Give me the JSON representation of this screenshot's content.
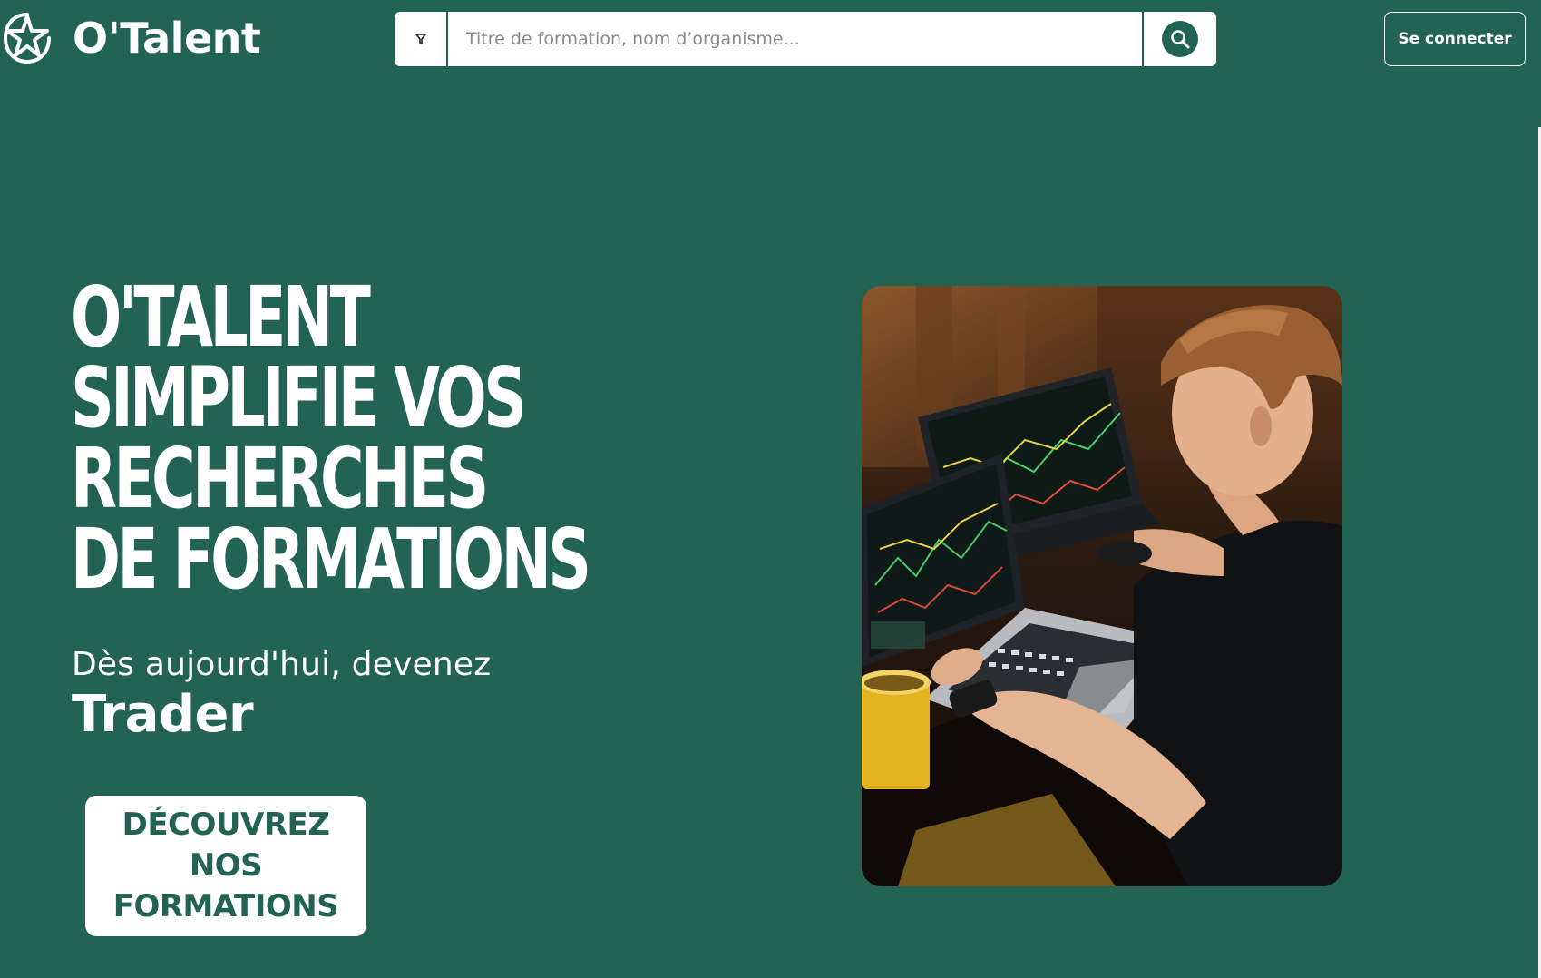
{
  "brand": {
    "name": "O'Talent",
    "logo_icon": "star-circle-logo"
  },
  "header": {
    "search": {
      "placeholder": "Titre de formation, nom d’organisme...",
      "filter_icon": "filter-icon",
      "search_icon": "search-icon"
    },
    "login_label": "Se connecter"
  },
  "hero": {
    "title_lines": [
      "O'TALENT",
      "SIMPLIFIE VOS",
      "RECHERCHES",
      "DE FORMATIONS"
    ],
    "subtitle": "Dès aujourd'hui, devenez",
    "role": "Trader",
    "cta_label": "DÉCOUVREZ NOS FORMATIONS"
  },
  "colors": {
    "brand_green": "#226354",
    "white": "#ffffff"
  }
}
